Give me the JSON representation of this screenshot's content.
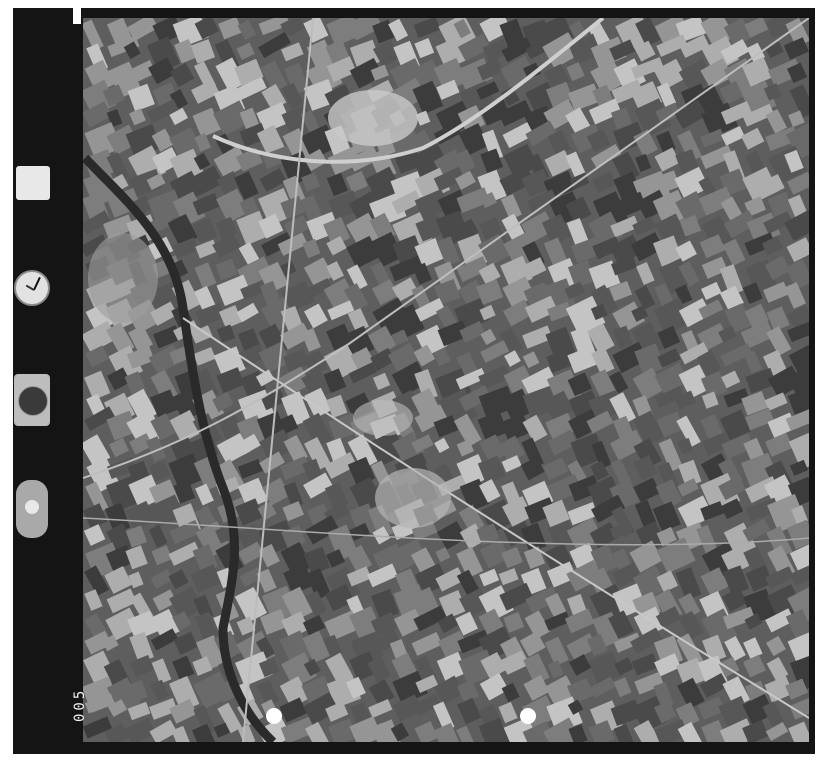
{
  "image": {
    "kind": "aerial photograph, black and white",
    "frame_number": "005",
    "instrument_note": "",
    "colors": {
      "film_border": "#141414",
      "terrain": "#6a6a6a",
      "field_light": "#bdbdbd",
      "field_dark": "#3c3c3c"
    }
  },
  "instruments": [
    "clock-icon",
    "altimeter-icon",
    "level-bubble-icon"
  ]
}
